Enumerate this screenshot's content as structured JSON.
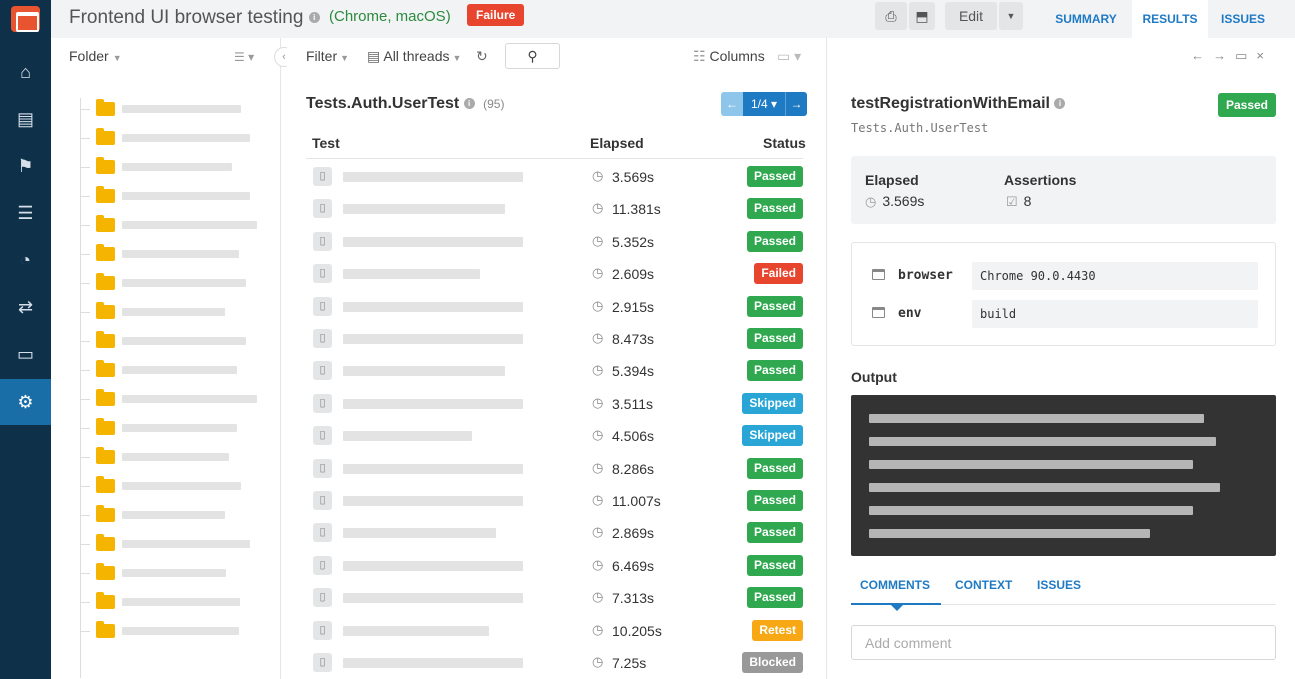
{
  "app": {
    "title": "Frontend UI browser testing",
    "environment": "(Chrome, macOS)",
    "run_status": "Failure",
    "edit_label": "Edit"
  },
  "nav_tabs": [
    "SUMMARY",
    "RESULTS",
    "ISSUES"
  ],
  "active_nav_tab": "RESULTS",
  "rail_icons": [
    "home-icon",
    "book-icon",
    "flag-icon",
    "list-icon",
    "pie-chart-icon",
    "sync-icon",
    "monitor-icon",
    "settings-icon"
  ],
  "folders": {
    "header": "Folder",
    "count": 19
  },
  "tests_toolbar": {
    "filter_label": "Filter",
    "threads_label": "All threads",
    "columns_label": "Columns"
  },
  "suite": {
    "name": "Tests.Auth.UserTest",
    "count": "(95)",
    "page": "1/4"
  },
  "table": {
    "columns": [
      "Test",
      "Elapsed",
      "Status"
    ],
    "rows": [
      {
        "elapsed": "3.569s",
        "status": "Passed"
      },
      {
        "elapsed": "11.381s",
        "status": "Passed"
      },
      {
        "elapsed": "5.352s",
        "status": "Passed"
      },
      {
        "elapsed": "2.609s",
        "status": "Failed"
      },
      {
        "elapsed": "2.915s",
        "status": "Passed"
      },
      {
        "elapsed": "8.473s",
        "status": "Passed"
      },
      {
        "elapsed": "5.394s",
        "status": "Passed"
      },
      {
        "elapsed": "3.511s",
        "status": "Skipped"
      },
      {
        "elapsed": "4.506s",
        "status": "Skipped"
      },
      {
        "elapsed": "8.286s",
        "status": "Passed"
      },
      {
        "elapsed": "11.007s",
        "status": "Passed"
      },
      {
        "elapsed": "2.869s",
        "status": "Passed"
      },
      {
        "elapsed": "6.469s",
        "status": "Passed"
      },
      {
        "elapsed": "7.313s",
        "status": "Passed"
      },
      {
        "elapsed": "10.205s",
        "status": "Retest"
      },
      {
        "elapsed": "7.25s",
        "status": "Blocked"
      }
    ]
  },
  "status_colors": {
    "Passed": "#2fa84f",
    "Failed": "#e8452e",
    "Skipped": "#2aa6d6",
    "Retest": "#f7a814",
    "Blocked": "#999999"
  },
  "detail": {
    "title": "testRegistrationWithEmail",
    "subtitle": "Tests.Auth.UserTest",
    "status": "Passed",
    "elapsed_label": "Elapsed",
    "elapsed_value": "3.569s",
    "assertions_label": "Assertions",
    "assertions_value": "8",
    "attributes": [
      {
        "key": "browser",
        "value": "Chrome 90.0.4430"
      },
      {
        "key": "env",
        "value": "build"
      }
    ],
    "output_label": "Output",
    "tabs": [
      "COMMENTS",
      "CONTEXT",
      "ISSUES"
    ],
    "active_tab": "COMMENTS",
    "comment_placeholder": "Add comment"
  },
  "colors": {
    "rail": "#0f3049",
    "accent": "#1f7ac4",
    "failure": "#e8452e"
  }
}
